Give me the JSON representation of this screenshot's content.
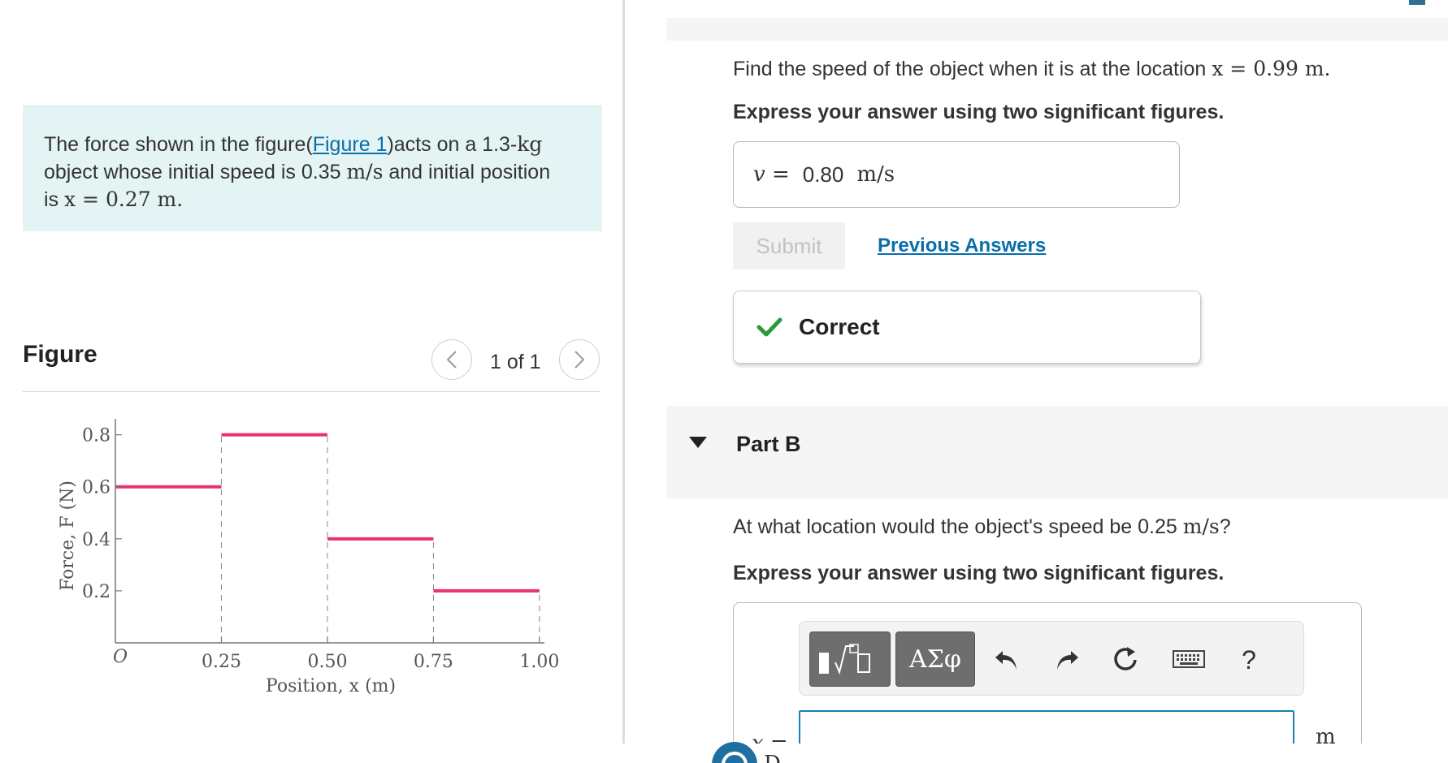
{
  "problem": {
    "text_before_link": "The force shown in the figure(",
    "figure_link": "Figure 1",
    "text_after_link": ")acts on a 1.3-",
    "mass_unit": "kg",
    "line2_a": "object whose initial speed is 0.35 ",
    "speed_unit": "m/s",
    "line2_b": " and initial position",
    "line3_a": "is ",
    "position_expr": "x = 0.27 m."
  },
  "figure": {
    "title": "Figure",
    "page_indicator": "1 of 1",
    "prev_icon": "chevron-left-icon",
    "next_icon": "chevron-right-icon"
  },
  "chart_data": {
    "type": "line",
    "subtype": "step",
    "xlabel": "Position, x (m)",
    "ylabel": "Force, F (N)",
    "origin_label": "O",
    "x_ticks": [
      "0.25",
      "0.50",
      "0.75",
      "1.00"
    ],
    "y_ticks": [
      "0.2",
      "0.4",
      "0.6",
      "0.8"
    ],
    "xlim": [
      0,
      1.05
    ],
    "ylim": [
      0,
      0.88
    ],
    "segments": [
      {
        "x0": 0,
        "x1": 0.25,
        "y": 0.6
      },
      {
        "x0": 0.25,
        "x1": 0.5,
        "y": 0.8
      },
      {
        "x0": 0.5,
        "x1": 0.75,
        "y": 0.4
      },
      {
        "x0": 0.75,
        "x1": 1.0,
        "y": 0.2
      }
    ],
    "line_color": "#e8336a",
    "grid": false
  },
  "part_a": {
    "question_a": "Find the speed of the object when it is at the location ",
    "question_math": "x = 0.99 m.",
    "hint": "Express your answer using two significant figures.",
    "answer_var": "v =",
    "answer_value": "0.80",
    "answer_unit": "m/s",
    "submit_label": "Submit",
    "previous_answers_label": "Previous Answers",
    "result_icon": "check-icon",
    "result_label": "Correct"
  },
  "part_b": {
    "title": "Part B",
    "question_a": "At what location would the object's speed be 0.25 ",
    "question_unit": "m/s",
    "question_b": "?",
    "hint": "Express your answer using two significant figures.",
    "toolbar": {
      "templates_icon": "templates-icon",
      "greek_label": "ΑΣφ",
      "undo_icon": "undo-icon",
      "redo_icon": "redo-icon",
      "reset_icon": "reset-icon",
      "keyboard_icon": "keyboard-icon",
      "help_label": "?"
    },
    "answer_var": "x =",
    "answer_unit": "m"
  },
  "colors": {
    "link": "#0a6ea8",
    "problem_bg": "#e4f4f4",
    "check": "#2a9a3c",
    "input_focus": "#1b7fb5"
  }
}
